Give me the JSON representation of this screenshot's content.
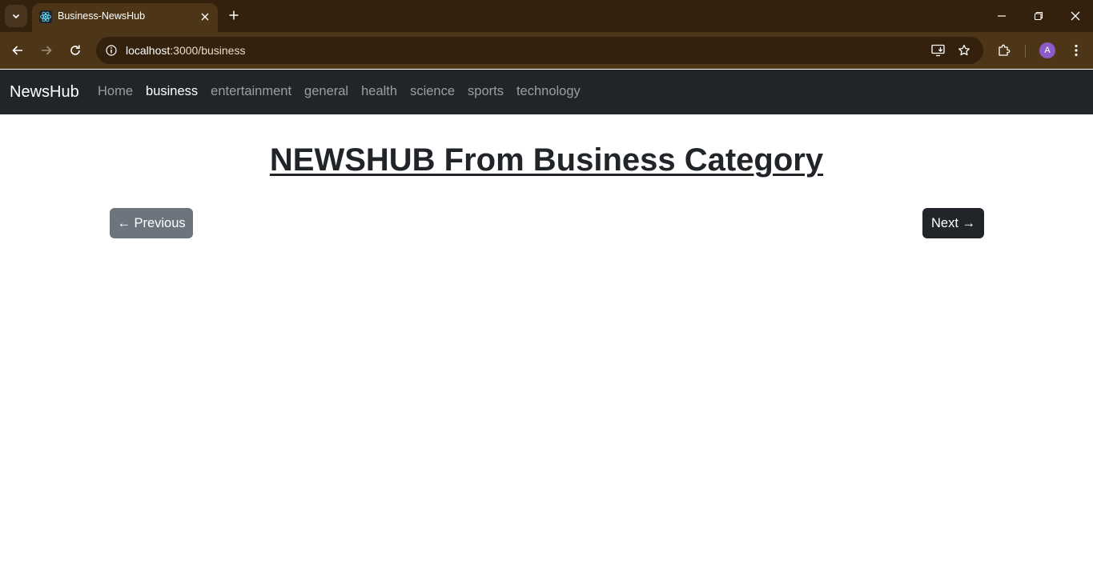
{
  "browser": {
    "tab_title": "Business-NewsHub",
    "url_host": "localhost",
    "url_rest": ":3000/business",
    "avatar_letter": "A",
    "colors": {
      "frame": "#33210d",
      "toolbar": "#4d3617",
      "avatar": "#8b5cc8"
    }
  },
  "navbar": {
    "brand": "NewsHub",
    "links": [
      {
        "label": "Home"
      },
      {
        "label": "business"
      },
      {
        "label": "entertainment"
      },
      {
        "label": "general"
      },
      {
        "label": "health"
      },
      {
        "label": "science"
      },
      {
        "label": "sports"
      },
      {
        "label": "technology"
      }
    ],
    "active_link": "business",
    "colors": {
      "background": "#212529"
    }
  },
  "main": {
    "heading": "NEWSHUB From Business Category",
    "prev_label": "← Previous",
    "next_label": "Next →",
    "colors": {
      "prev_button": "#6c757d",
      "next_button": "#212529"
    }
  }
}
